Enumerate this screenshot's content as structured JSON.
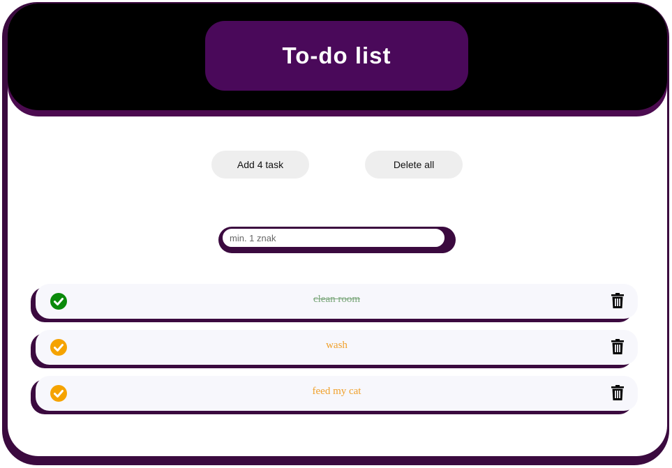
{
  "header": {
    "title": "To-do list"
  },
  "toolbar": {
    "add_label": "Add 4 task",
    "delete_all_label": "Delete all"
  },
  "input": {
    "placeholder": "min. 1 znak",
    "value": ""
  },
  "tasks": [
    {
      "text": "clean room",
      "done": true,
      "icon": "check-circle-icon"
    },
    {
      "text": "wash",
      "done": false,
      "icon": "check-circle-icon"
    },
    {
      "text": "feed my cat",
      "done": false,
      "icon": "check-circle-icon"
    }
  ],
  "colors": {
    "header_bg": "#000000",
    "accent": "#4a095a",
    "shadow": "#3b0a3f",
    "done_check": "#0b8a0b",
    "pending_check": "#f5a300",
    "done_text": "#7aa67a",
    "pending_text": "#f0a02a"
  }
}
